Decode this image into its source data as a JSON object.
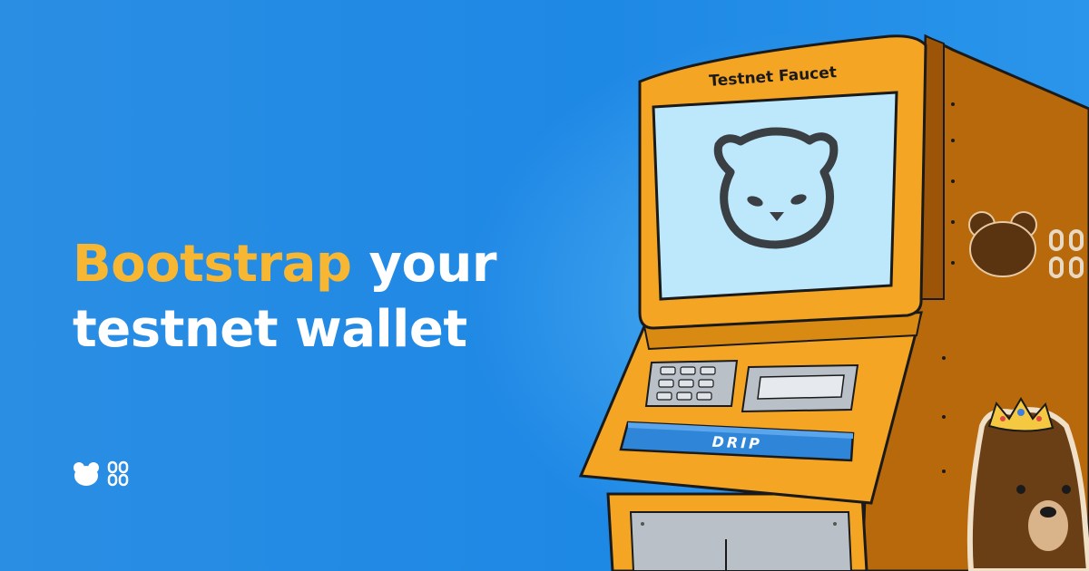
{
  "headline": {
    "accent": "Bootstrap",
    "line1_rest": " your",
    "line2": "testnet wallet"
  },
  "machine": {
    "title": "Testnet Faucet",
    "button_label": "DRIP"
  },
  "colors": {
    "background": "#1e88e5",
    "accent": "#f7b733",
    "machine_body": "#f5a524",
    "screen": "#bde8fb",
    "button": "#2f86d8"
  },
  "icons": [
    "bear-logo-icon",
    "chain-link-icon",
    "bear-face-icon",
    "crown-bear-sticker"
  ]
}
